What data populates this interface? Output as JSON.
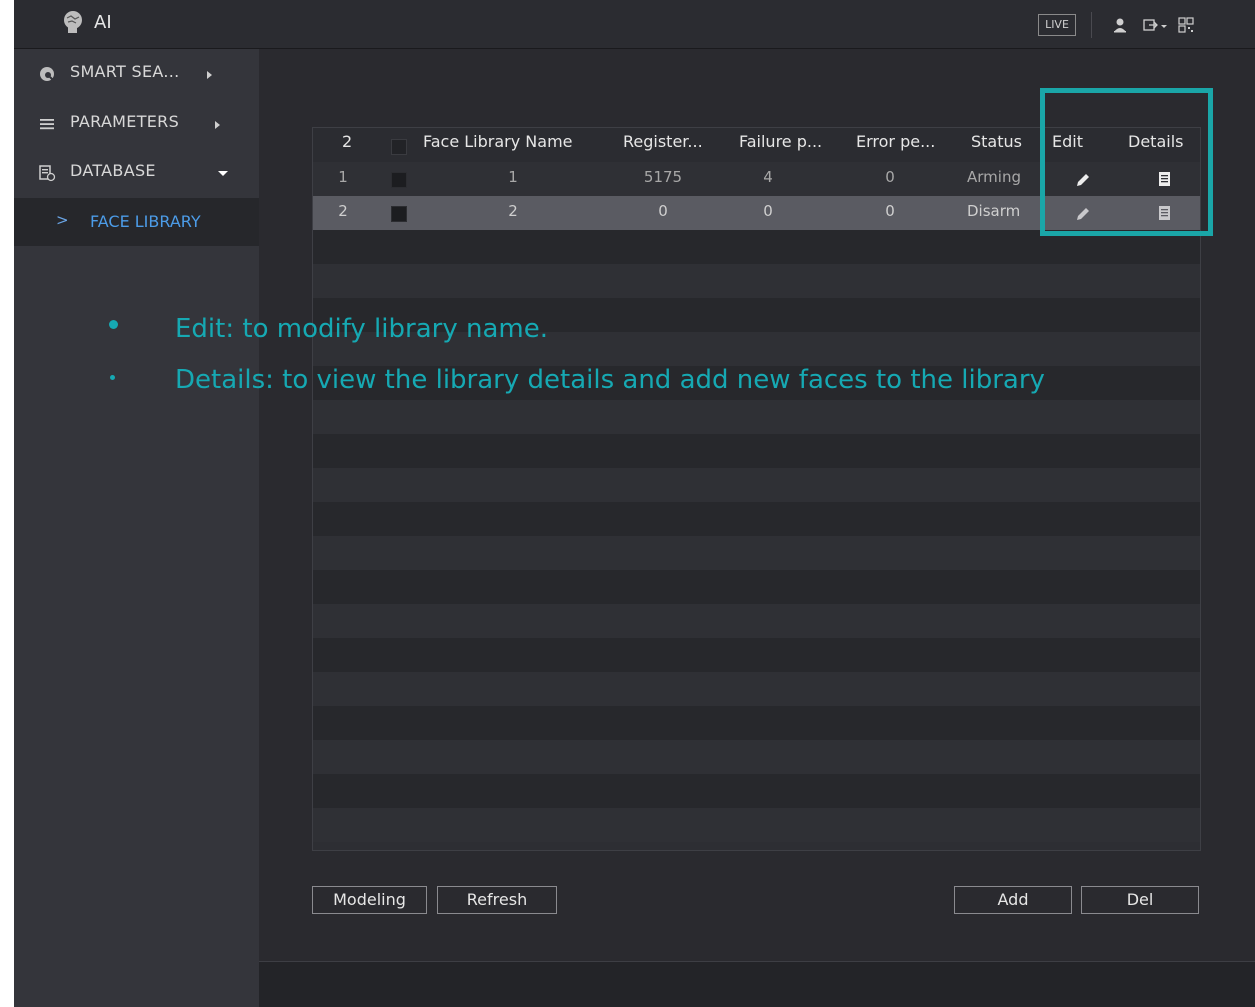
{
  "header": {
    "title": "AI",
    "live_label": "LIVE"
  },
  "sidebar": {
    "items": [
      {
        "label": "SMART SEA...",
        "icon": "smart-search-icon"
      },
      {
        "label": "PARAMETERS",
        "icon": "list-icon"
      },
      {
        "label": "DATABASE",
        "icon": "database-icon"
      }
    ],
    "sub_item": {
      "label": "FACE LIBRARY",
      "chevron": ">"
    }
  },
  "table": {
    "columns": [
      "2",
      "",
      "Face Library Name",
      "Register...",
      "Failure p...",
      "Error pe...",
      "Status",
      "Edit",
      "Details"
    ],
    "rows": [
      {
        "index": "1",
        "name": "1",
        "registered": "5175",
        "failure": "4",
        "error": "0",
        "status": "Arming"
      },
      {
        "index": "2",
        "name": "2",
        "registered": "0",
        "failure": "0",
        "error": "0",
        "status": "Disarm"
      }
    ]
  },
  "annotations": {
    "edit_note": "Edit: to modify library name.",
    "details_note": "Details: to view the library details and add new faces to the library",
    "color": "#16a9b3"
  },
  "buttons": {
    "modeling": "Modeling",
    "refresh": "Refresh",
    "add": "Add",
    "del": "Del"
  },
  "colors": {
    "highlight": "#1aa6a8",
    "active_link": "#4c9ce8"
  }
}
